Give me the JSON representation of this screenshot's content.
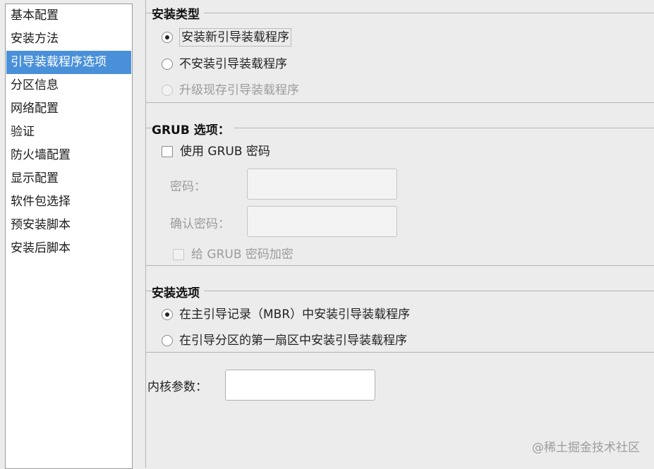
{
  "sidebar": {
    "items": [
      {
        "label": "基本配置"
      },
      {
        "label": "安装方法"
      },
      {
        "label": "引导装载程序选项"
      },
      {
        "label": "分区信息"
      },
      {
        "label": "网络配置"
      },
      {
        "label": "验证"
      },
      {
        "label": "防火墙配置"
      },
      {
        "label": "显示配置"
      },
      {
        "label": "软件包选择"
      },
      {
        "label": "预安装脚本"
      },
      {
        "label": "安装后脚本"
      }
    ],
    "selected_label": "引导装载程序选项"
  },
  "install_type": {
    "title": "安装类型",
    "options": [
      {
        "label": "安装新引导装载程序",
        "checked": true,
        "enabled": true
      },
      {
        "label": "不安装引导装载程序",
        "checked": false,
        "enabled": true
      },
      {
        "label": "升级现存引导装载程序",
        "checked": false,
        "enabled": false
      }
    ]
  },
  "grub": {
    "title": "GRUB 选项：",
    "use_password_label": "使用  GRUB 密码",
    "password_label": "密码：",
    "password_value": "",
    "confirm_label": "确认密码：",
    "confirm_value": "",
    "encrypt_label": "给  GRUB 密码加密"
  },
  "install_options": {
    "title": "安装选项",
    "options": [
      {
        "label": "在主引导记录（MBR）中安装引导装载程序",
        "checked": true
      },
      {
        "label": "在引导分区的第一扇区中安装引导装载程序",
        "checked": false
      }
    ]
  },
  "kernel": {
    "label": "内核参数：",
    "value": ""
  },
  "watermark": "@稀土掘金技术社区",
  "colors": {
    "selection": "#4a90d9",
    "background": "#ececec",
    "disabled_text": "#9c9c9c"
  }
}
